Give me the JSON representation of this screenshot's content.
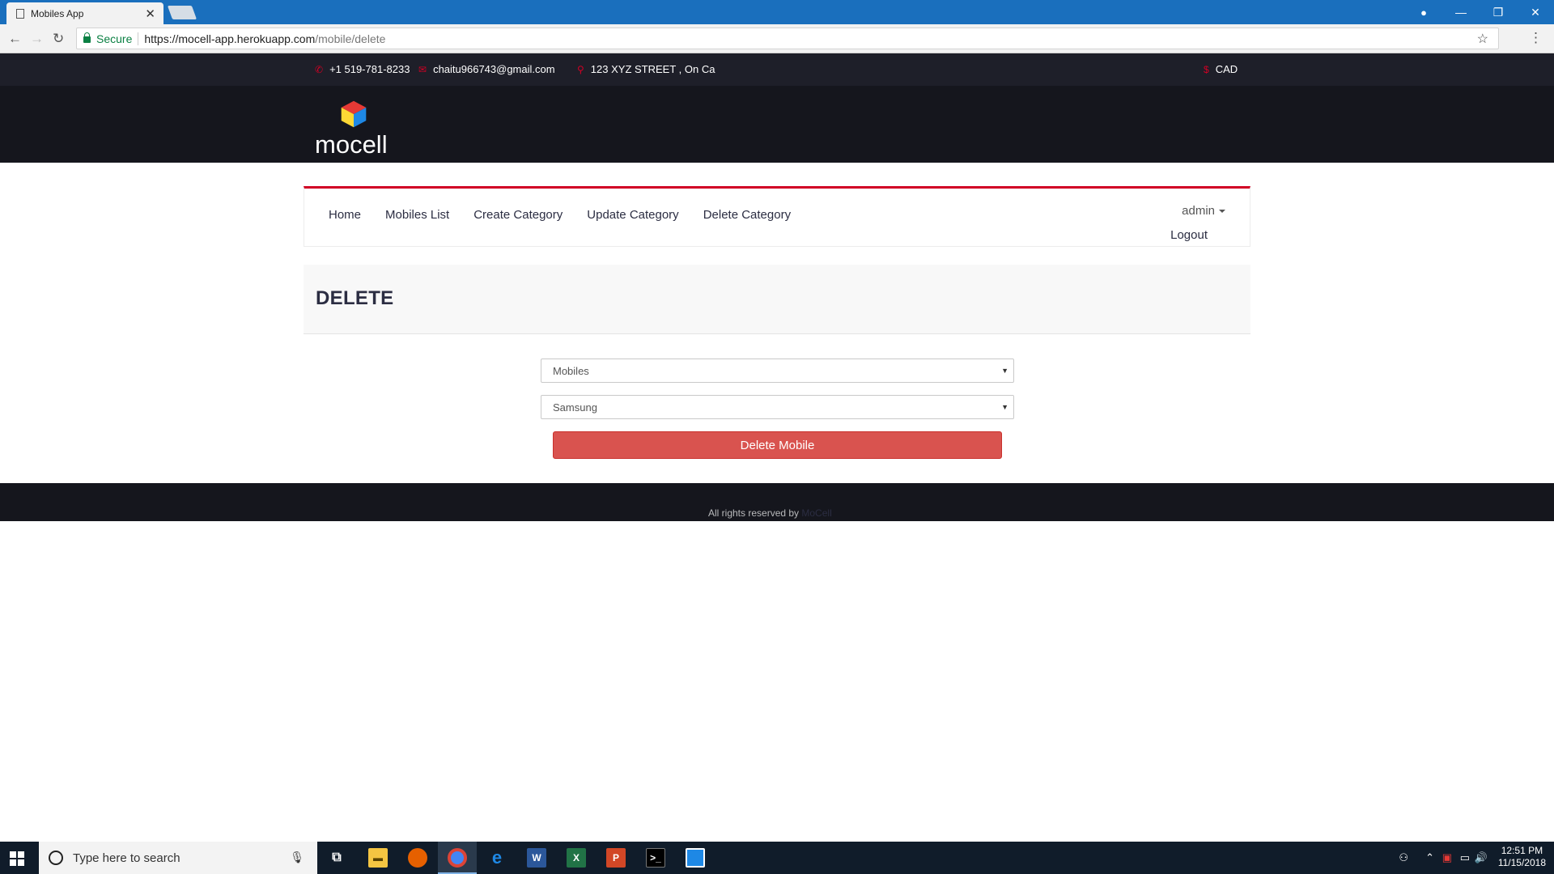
{
  "browser": {
    "tab_title": "Mobiles App",
    "secure_label": "Secure",
    "url_scheme_host": "https://mocell-app.herokuapp.com",
    "url_path": "/mobile/delete"
  },
  "topbar": {
    "phone": "+1 519-781-8233",
    "email": "chaitu966743@gmail.com",
    "address": "123 XYZ STREET , On Ca",
    "currency": "CAD"
  },
  "header": {
    "logo_text": "mocell"
  },
  "nav": {
    "links": [
      "Home",
      "Mobiles List",
      "Create Category",
      "Update Category",
      "Delete Category"
    ],
    "user": "admin",
    "logout": "Logout"
  },
  "page": {
    "title": "DELETE",
    "category_select": "Mobiles",
    "mobile_select": "Samsung",
    "delete_button": "Delete Mobile"
  },
  "footer": {
    "text": "All rights reserved by ",
    "link": "MoCell"
  },
  "taskbar": {
    "search_placeholder": "Type here to search",
    "time": "12:51 PM",
    "date": "11/15/2018"
  },
  "colors": {
    "accent": "#d10024",
    "danger": "#d9534f",
    "dark": "#15161d"
  }
}
